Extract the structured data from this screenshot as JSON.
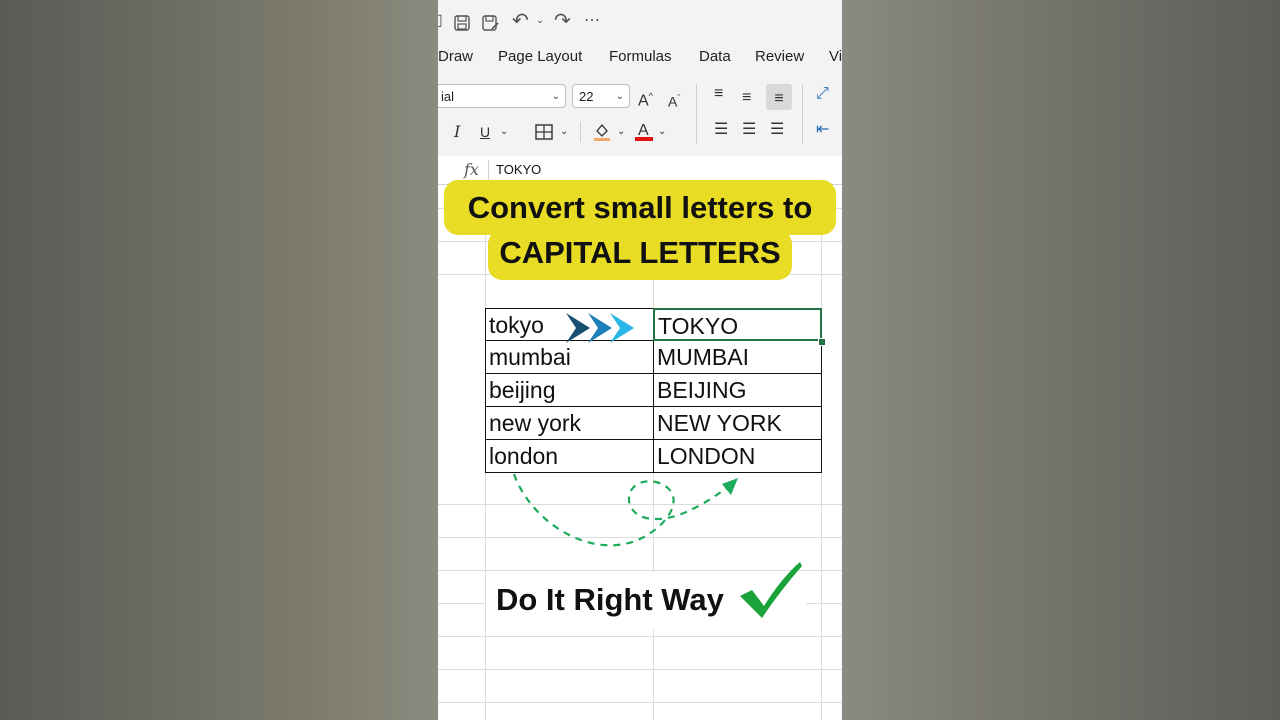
{
  "ribbon_tabs": [
    "Draw",
    "Page Layout",
    "Formulas",
    "Data",
    "Review",
    "Vi"
  ],
  "font": {
    "name": "ial",
    "size": "22"
  },
  "formula_bar": {
    "fx": "fx",
    "value": "TOKYO"
  },
  "banner": {
    "line1": "Convert small letters to",
    "line2": "CAPITAL LETTERS"
  },
  "table": {
    "rows": [
      {
        "lower": "tokyo",
        "upper": "TOKYO"
      },
      {
        "lower": "mumbai",
        "upper": "MUMBAI"
      },
      {
        "lower": "beijing",
        "upper": "BEIJING"
      },
      {
        "lower": "new york",
        "upper": "NEW YORK"
      },
      {
        "lower": "london",
        "upper": "LONDON"
      }
    ]
  },
  "caption": "Do It Right Way",
  "colors": {
    "banner": "#e8dc24",
    "selection": "#217346",
    "check": "#1aa33a",
    "arrows": "#1fa3d6",
    "dashed": "#1daa5a"
  },
  "icons": [
    "autosave-icon",
    "save-icon",
    "save-as-icon",
    "undo-icon",
    "redo-icon",
    "more-icon",
    "increase-font-icon",
    "decrease-font-icon",
    "italic-icon",
    "underline-icon",
    "borders-icon",
    "fill-color-icon",
    "font-color-icon",
    "align-top-icon",
    "align-middle-icon",
    "align-bottom-icon",
    "orientation-icon",
    "align-left-icon",
    "align-center-icon",
    "align-right-icon",
    "decrease-indent-icon"
  ]
}
